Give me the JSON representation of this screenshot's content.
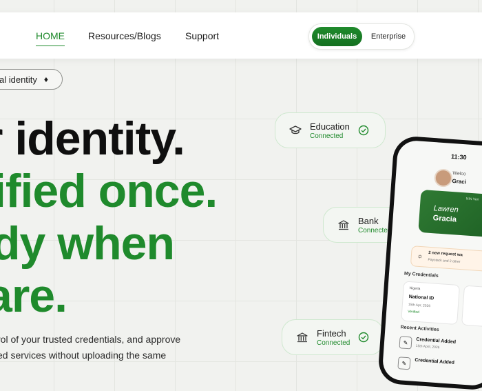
{
  "nav": {
    "home": "HOME",
    "resources": "Resources/Blogs",
    "support": "Support",
    "toggle": {
      "individuals": "Individuals",
      "enterprise": "Enterprise"
    }
  },
  "pill": {
    "label": "al identity",
    "icon": "diamond-icon"
  },
  "hero": {
    "line1": "r identity.",
    "line2": "ified once.",
    "line3": "dy when",
    "line4": "are.",
    "body1": "rol of your trusted credentials, and approve",
    "body2": "ed services without uploading the same"
  },
  "cards": {
    "education": {
      "title": "Education",
      "status": "Connected",
      "icon": "graduation-cap-icon"
    },
    "bank": {
      "title": "Bank",
      "status": "Connected",
      "icon": "bank-icon"
    },
    "fintech": {
      "title": "Fintech",
      "status": "Connected",
      "icon": "bank-icon"
    }
  },
  "phone": {
    "time": "11:30",
    "welcome": "Welco",
    "username": "Graci",
    "nin_label": "NIN Veri",
    "nin_name1": "Lawren",
    "nin_name2": "Gracia",
    "request_title": "2 new request wa",
    "request_sub": "Paystack and 2 other",
    "my_credentials": "My Credentials",
    "cred": {
      "country": "Nigeria",
      "title": "National ID",
      "date": "15th Apr, 2026",
      "status": "Verified"
    },
    "recent_activities": "Recent Activities",
    "activities": [
      {
        "title": "Credential Added",
        "date": "15th April, 2026"
      },
      {
        "title": "Credential Added",
        "date": ""
      }
    ]
  },
  "colors": {
    "brand_green": "#1f8a2c",
    "background": "#f1f2ef"
  }
}
